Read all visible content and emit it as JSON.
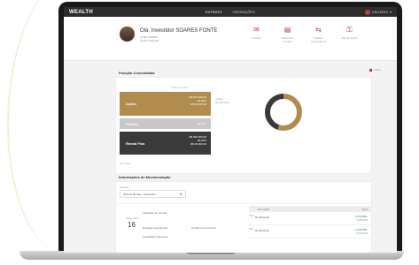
{
  "app": {
    "logo": "WEALTH"
  },
  "topnav": {
    "items": [
      "EXTRATO",
      "OPERAÇÕES"
    ],
    "active": 0
  },
  "user": {
    "name": "USUÁRIO"
  },
  "profile": {
    "name": "Olá, Investidor SOARES FONTE",
    "line1": "Conta: 000000",
    "line2": "Perfil moderado"
  },
  "actions": [
    {
      "icon": "mail-icon",
      "glyph": "✉",
      "label": "Contato"
    },
    {
      "icon": "document-icon",
      "glyph": "▤",
      "label": "Relatórios mensais"
    },
    {
      "icon": "transfer-icon",
      "glyph": "⇆",
      "label": "Solicitar transferência"
    },
    {
      "icon": "key-icon",
      "glyph": "⚿",
      "label": "Alterar senha"
    }
  ],
  "filter": {
    "label": "Filtrar"
  },
  "position": {
    "title": "Posição Consolidada",
    "header": "Total investido",
    "cards": [
      {
        "title": "Ações",
        "lines": [
          "R$ 000.000,00",
          "00,00%",
          "R$ 00.000,00"
        ]
      },
      {
        "title": "Fundos",
        "lines": [
          "R$ 0,00"
        ]
      },
      {
        "title": "Renda Fixa",
        "lines": [
          "R$ 000.000,00",
          "00,00%",
          "R$ 00.000,00"
        ]
      }
    ],
    "legend": [
      "Ações",
      "Renda Fixa"
    ],
    "footer": "Ver mais",
    "chart_data": {
      "type": "pie",
      "labels": [
        "Ações",
        "Renda Fixa"
      ],
      "values": [
        55,
        45
      ],
      "colors": [
        "#b08d4f",
        "#3a3a3a"
      ]
    }
  },
  "movements": {
    "title": "Informações de Movimentação",
    "period_label": "Período",
    "period_value": "Últimos 30 dias - Dezembro",
    "table_headers": [
      "Descrição",
      "Valor"
    ],
    "rows": [
      {
        "code": "DEZ",
        "desc": "Rendimento",
        "value": "+0,00 BRL",
        "sub": "00/00/0000"
      },
      {
        "code": "DEZ",
        "desc": "Rendimento",
        "value": "+0,00 BRL",
        "sub": "00/00/0000"
      }
    ],
    "day": "16",
    "month": "Dezembro",
    "events": [
      "Aplicação em fundos",
      "Resgate programado",
      "Crédito de proventos",
      "Liquidação financeira"
    ]
  }
}
